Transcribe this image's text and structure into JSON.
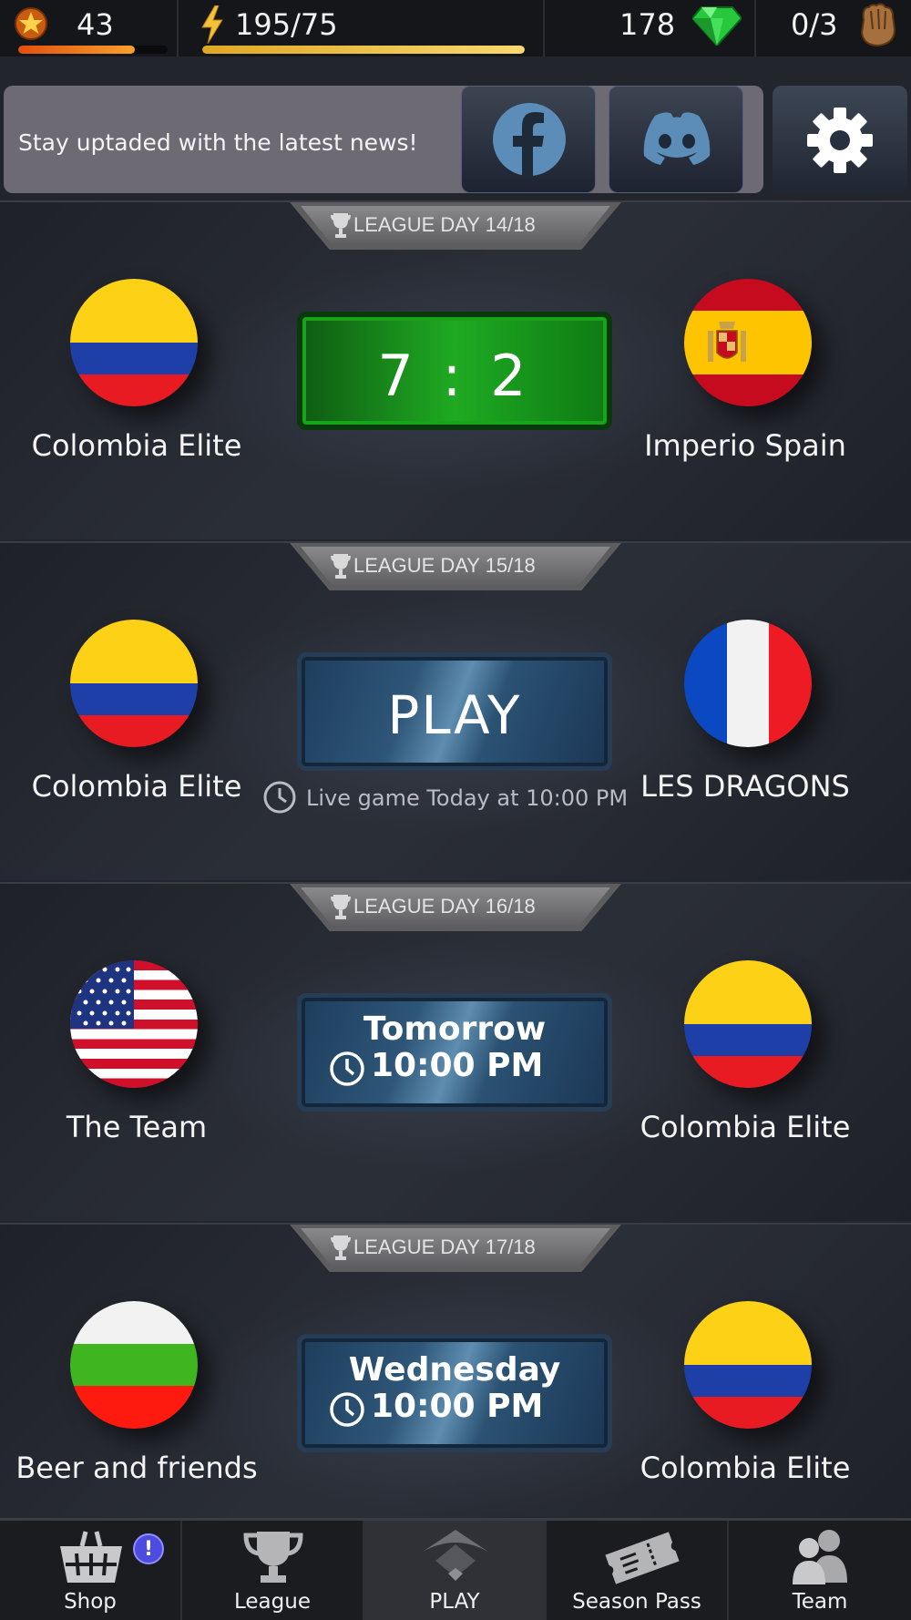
{
  "resources": {
    "level": "43",
    "level_progress": 0.78,
    "energy": "195/75",
    "energy_progress": 1.0,
    "gems": "178",
    "gloves": "0/3"
  },
  "news": {
    "text": "Stay uptaded with the latest news!"
  },
  "matches": [
    {
      "day": "LEAGUE DAY 14/18",
      "home": "Colombia Elite",
      "away": "Imperio Spain",
      "score": "7 : 2"
    },
    {
      "day": "LEAGUE DAY 15/18",
      "home": "Colombia Elite",
      "away": "LES DRAGONS",
      "play": "PLAY",
      "live": "Live game Today at 10:00 PM"
    },
    {
      "day": "LEAGUE DAY 16/18",
      "home": "The Team",
      "away": "Colombia Elite",
      "when": "Tomorrow",
      "time": "10:00 PM"
    },
    {
      "day": "LEAGUE DAY 17/18",
      "home": "Beer and friends",
      "away": "Colombia Elite",
      "when": "Wednesday",
      "time": "10:00 PM"
    }
  ],
  "nav": {
    "shop": "Shop",
    "shop_badge": "!",
    "league": "League",
    "play": "PLAY",
    "season_pass": "Season Pass",
    "team": "Team"
  },
  "colors": {
    "score_green": "#1faa22",
    "blue_button": "#2e5678",
    "level_bar": "#f08a1c",
    "energy_bar": "#f2c23a",
    "badge_purple": "#4e4ce0"
  }
}
